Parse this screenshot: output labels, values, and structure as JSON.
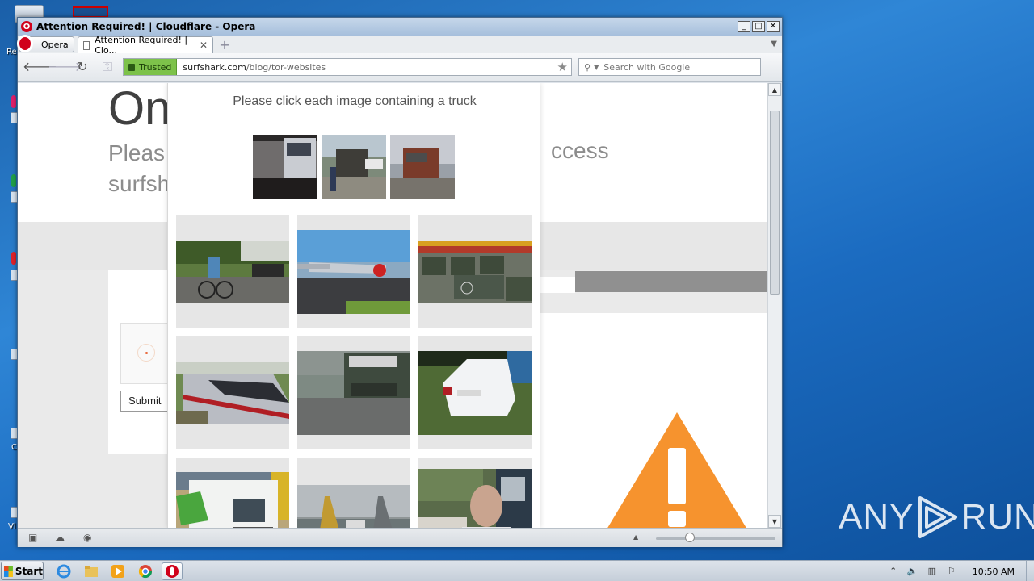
{
  "desktop": {
    "labels": [
      "Re",
      "C",
      "Vl"
    ]
  },
  "window": {
    "title": "Attention Required! | Cloudflare - Opera",
    "buttons": {
      "minimize": "_",
      "maximize": "□",
      "close": "✕"
    }
  },
  "tabs": {
    "menu_label": "Opera",
    "active_tab_label": "Attention Required! | Clo...",
    "close_glyph": "✕",
    "new_tab_glyph": "+"
  },
  "address": {
    "security_label": "Trusted",
    "url_domain": "surfshark.com",
    "url_path": "/blog/tor-websites",
    "search_placeholder": "Search with Google"
  },
  "page": {
    "heading_partial": "On",
    "line1_partial": "Pleas",
    "line2_partial": "surfsh",
    "line1_right": "ccess",
    "submit_label": "Submit"
  },
  "challenge": {
    "prompt": "Please click each image containing a truck",
    "examples": [
      "truck-example-1",
      "truck-example-2",
      "truck-example-3"
    ],
    "tiles": [
      {
        "subject": "cyclists on road"
      },
      {
        "subject": "small airplane"
      },
      {
        "subject": "military trucks parade"
      },
      {
        "subject": "high-speed train"
      },
      {
        "subject": "green car rear"
      },
      {
        "subject": "white sedan"
      },
      {
        "subject": "refrigerated truck"
      },
      {
        "subject": "propeller airplane"
      },
      {
        "subject": "person near bus"
      }
    ]
  },
  "watermark": {
    "left": "ANY",
    "right": "RUN"
  },
  "taskbar": {
    "start_label": "Start",
    "apps": [
      "ie-icon",
      "explorer-icon",
      "media-player-icon",
      "chrome-icon",
      "opera-icon"
    ],
    "clock": "10:50 AM"
  },
  "colors": {
    "trusted_green": "#7dc24a",
    "warning_orange": "#f6932e",
    "opera_red": "#d0011b"
  }
}
